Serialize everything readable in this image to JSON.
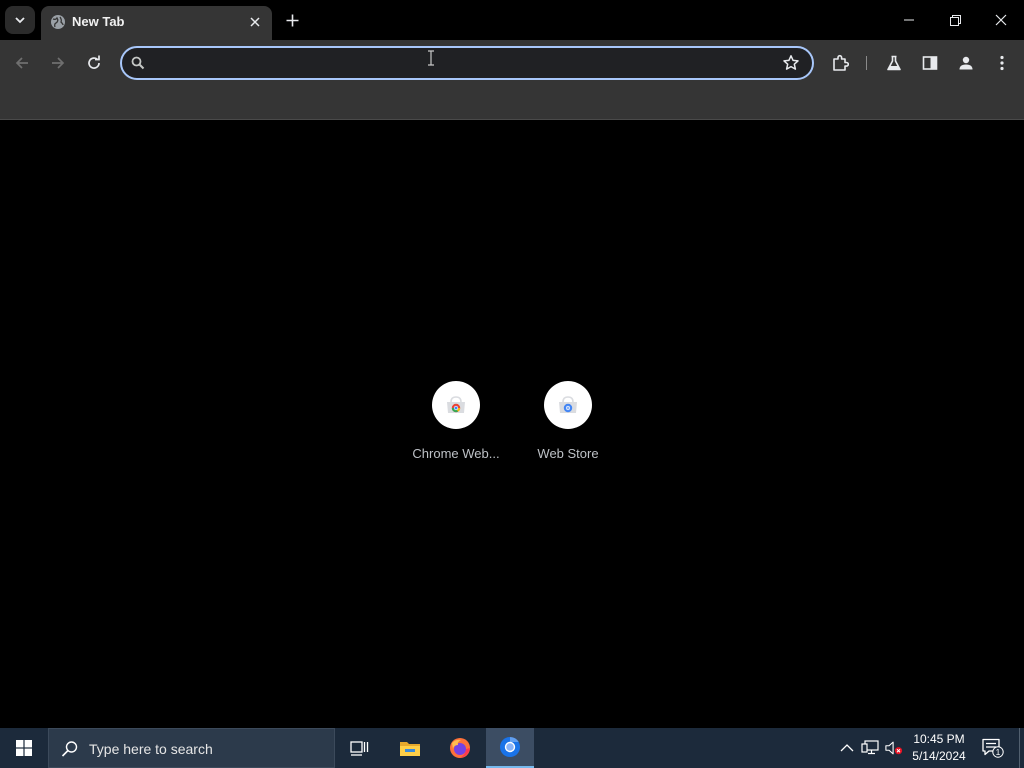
{
  "browser": {
    "tab": {
      "title": "New Tab"
    },
    "omnibox": {
      "value": "",
      "placeholder": ""
    },
    "accent_color": "#a8c7fa"
  },
  "shortcuts": [
    {
      "label": "Chrome Web...",
      "icon": "chrome-web-store-icon"
    },
    {
      "label": "Web Store",
      "icon": "web-store-icon"
    }
  ],
  "taskbar": {
    "search_placeholder": "Type here to search",
    "clock_time": "10:45 PM",
    "clock_date": "5/14/2024",
    "notification_count": "1",
    "apps": [
      "task-view-icon",
      "file-explorer-icon",
      "firefox-icon",
      "chrome-icon"
    ]
  }
}
